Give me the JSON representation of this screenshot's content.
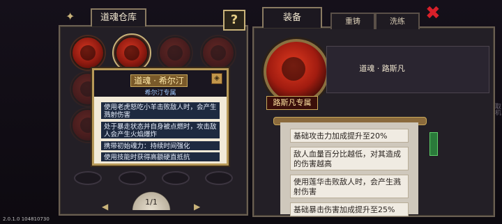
{
  "warehouse": {
    "title": "道魂仓库",
    "help_glyph": "?",
    "page": "1/1"
  },
  "tooltip": {
    "name": "道魂 · 希尔汀",
    "exclusive": "希尔汀专属",
    "lines": [
      "使用老虎怒吃小羊击败敌人时，会产生溅射伤害",
      "处于暴走状态并自身被点燃时，攻击敌人会产生火焰爆炸",
      "携带初始魂力：持续时间强化",
      "使用技能时获得高额硬直抵抗"
    ]
  },
  "equip": {
    "title": "装备",
    "tabs": [
      "重铸",
      "洗练"
    ],
    "soul_name": "道魂 · 路斯凡",
    "exclusive": "路斯凡专属",
    "effects": [
      "基础攻击力加成提升至20%",
      "敌人血量百分比越低，对其造成的伤害越高",
      "使用莲华击败敌人时，会产生溅射伤害",
      "基础暴击伤害加成提升至25%"
    ],
    "side_label": "取机"
  },
  "footer": {
    "version": "2.0.1.0 104810730"
  },
  "colors": {
    "accent": "#c9b37a",
    "orb_red": "#d23520",
    "panel_bg": "#231f26"
  }
}
